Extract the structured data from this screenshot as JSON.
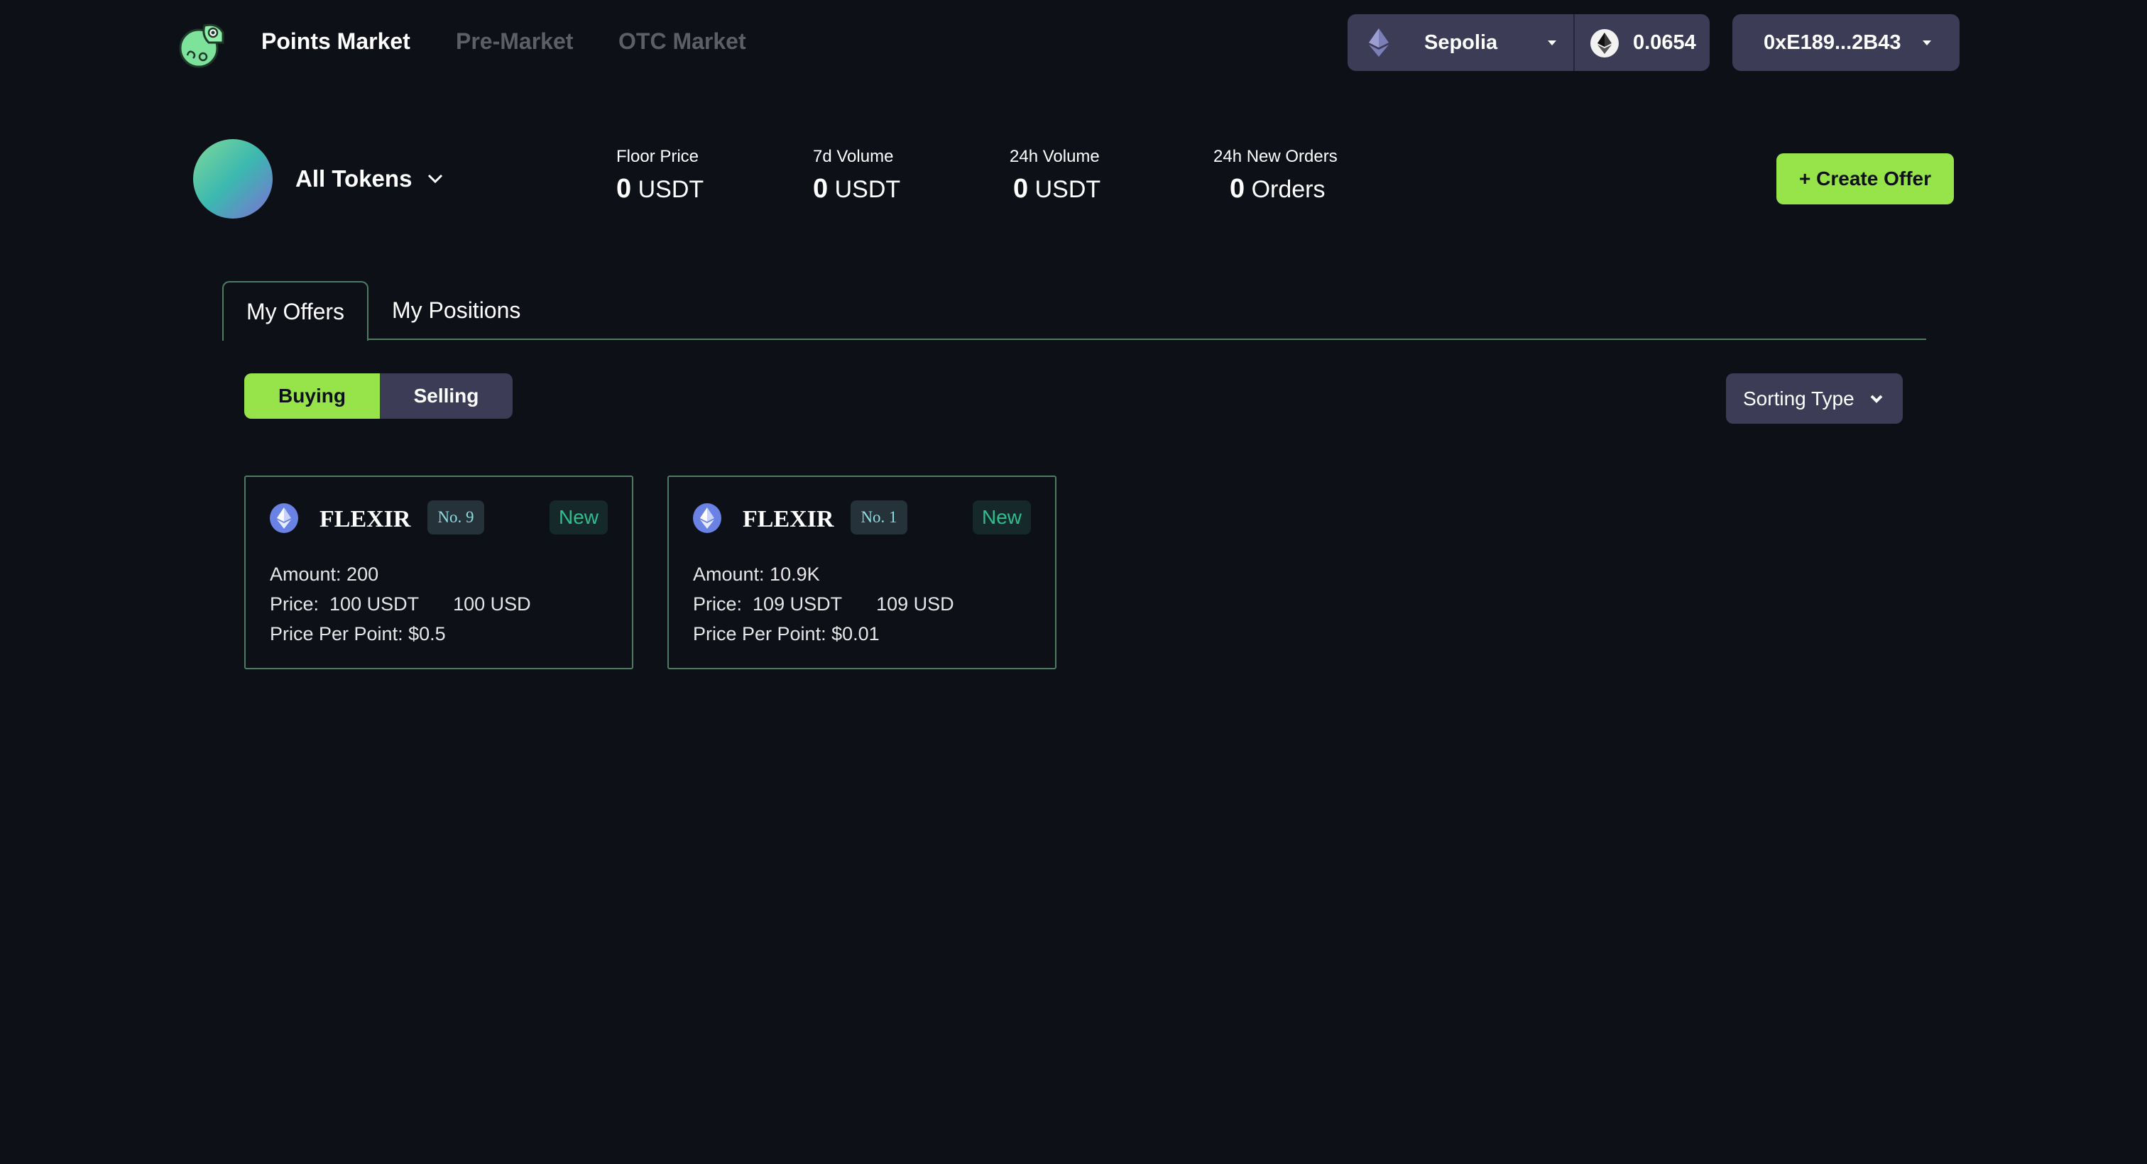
{
  "nav": {
    "brand_icon": "chameleon-logo-icon",
    "links": [
      {
        "label": "Points Market",
        "active": true
      },
      {
        "label": "Pre-Market",
        "active": false
      },
      {
        "label": "OTC Market",
        "active": false
      }
    ],
    "network": {
      "icon": "ethereum-icon",
      "label": "Sepolia"
    },
    "balance": {
      "icon": "ethereum-icon",
      "value": "0.0654"
    },
    "wallet": {
      "address": "0xE189...2B43"
    }
  },
  "token_header": {
    "selector_label": "All Tokens",
    "stats": [
      {
        "label": "Floor Price",
        "value": "0",
        "unit": "USDT"
      },
      {
        "label": "7d Volume",
        "value": "0",
        "unit": "USDT"
      },
      {
        "label": "24h Volume",
        "value": "0",
        "unit": "USDT"
      },
      {
        "label": "24h New Orders",
        "value": "0",
        "unit": "Orders"
      }
    ],
    "create_offer_label": "+ Create Offer"
  },
  "tabs": [
    {
      "label": "My Offers",
      "active": true
    },
    {
      "label": "My Positions",
      "active": false
    }
  ],
  "filter": {
    "segments": [
      {
        "label": "Buying",
        "active": true
      },
      {
        "label": "Selling",
        "active": false
      }
    ],
    "sort_label": "Sorting Type"
  },
  "offers": [
    {
      "token": "FLEXIR",
      "number": "No. 9",
      "status": "New",
      "amount_label": "Amount: 200",
      "price_prefix": "Price:  ",
      "price_usdt": "100 USDT",
      "price_usd": "100 USD",
      "ppp_label": "Price Per Point: $0.5"
    },
    {
      "token": "FLEXIR",
      "number": "No. 1",
      "status": "New",
      "amount_label": "Amount: 10.9K",
      "price_prefix": "Price:  ",
      "price_usdt": "109 USDT",
      "price_usd": "109 USD",
      "ppp_label": "Price Per Point: $0.01"
    }
  ],
  "colors": {
    "background": "#0d1017",
    "accent_green": "#97e34a",
    "pill_bg": "#3c3c57",
    "border_green": "#4e7b62",
    "status_new": "#2fbf8f"
  }
}
